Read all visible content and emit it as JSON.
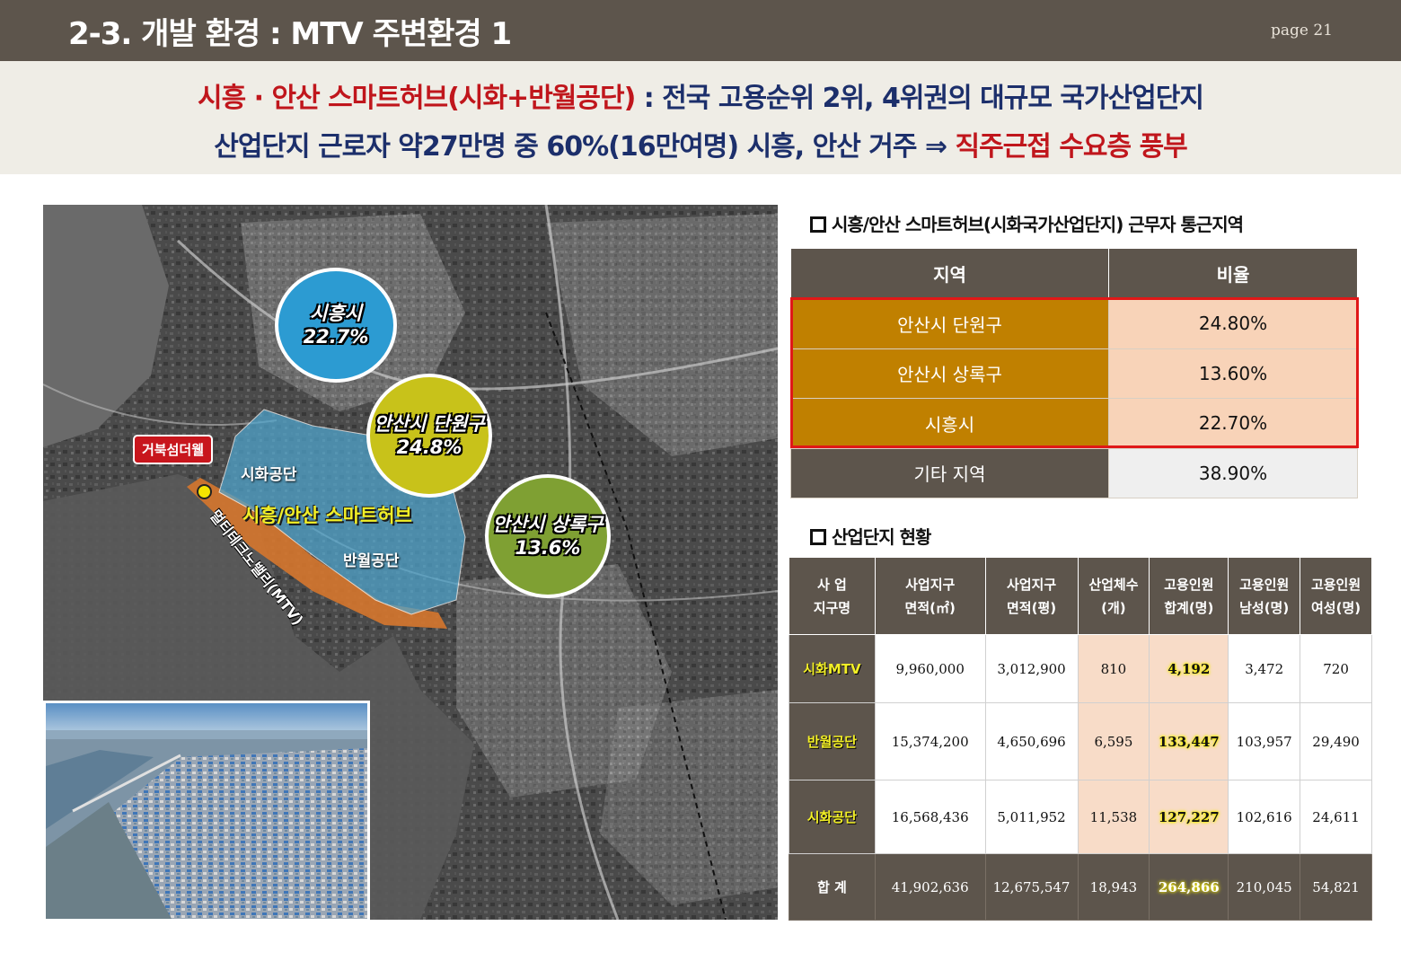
{
  "header": {
    "title": "2-3. 개발 환경 : MTV 주변환경 1",
    "page": "page 21"
  },
  "subtitle": {
    "line1_red": "시흥 · 안산 스마트허브(시화+반월공단)",
    "line1_navy": " : 전국 고용순위 2위, 4위권의 대규모 국가산업단지",
    "line2_navy": "산업단지 근로자 약27만명 중 60%(16만여명) 시흥, 안산 거주 ⇒ ",
    "line2_red": "직주근접 수요층 풍부"
  },
  "map": {
    "bubbles": [
      {
        "name": "시흥시",
        "value": "22.7%",
        "color": "#2c9bd2"
      },
      {
        "name": "안산시 단원구",
        "value": "24.8%",
        "color": "#c8c21a"
      },
      {
        "name": "안산시 상록구",
        "value": "13.6%",
        "color": "#7fa033"
      }
    ],
    "hub_label": "시흥/안산 스마트허브",
    "sihwa_label": "시화공단",
    "banwol_label": "반월공단",
    "mtv_label": "멀티테크노밸리(MTV)",
    "callout": "거북섬더웰"
  },
  "commute": {
    "title": "시흥/안산 스마트허브(시화국가산업단지) 근무자 통근지역",
    "headers": [
      "지역",
      "비율"
    ],
    "rows": [
      {
        "region": "안산시 단원구",
        "ratio": "24.80%"
      },
      {
        "region": "안산시 상록구",
        "ratio": "13.60%"
      },
      {
        "region": "시흥시",
        "ratio": "22.70%"
      },
      {
        "region": "기타 지역",
        "ratio": "38.90%"
      }
    ]
  },
  "industrial": {
    "title": "산업단지 현황",
    "headers": [
      [
        "사   업",
        "지구명"
      ],
      [
        "사업지구",
        "면적(㎡)"
      ],
      [
        "사업지구",
        "면적(평)"
      ],
      [
        "산업체수",
        "(개)"
      ],
      [
        "고용인원",
        "합계(명)"
      ],
      [
        "고용인원",
        "남성(명)"
      ],
      [
        "고용인원",
        "여성(명)"
      ]
    ],
    "rows": [
      {
        "name": "시화MTV",
        "area_m2": "9,960,000",
        "area_py": "3,012,900",
        "companies": "810",
        "total": "4,192",
        "male": "3,472",
        "female": "720"
      },
      {
        "name": "반월공단",
        "area_m2": "15,374,200",
        "area_py": "4,650,696",
        "companies": "6,595",
        "total": "133,447",
        "male": "103,957",
        "female": "29,490"
      },
      {
        "name": "시화공단",
        "area_m2": "16,568,436",
        "area_py": "5,011,952",
        "companies": "11,538",
        "total": "127,227",
        "male": "102,616",
        "female": "24,611"
      }
    ],
    "total": {
      "name": "합 계",
      "area_m2": "41,902,636",
      "area_py": "12,675,547",
      "companies": "18,943",
      "total": "264,866",
      "male": "210,045",
      "female": "54,821"
    }
  }
}
